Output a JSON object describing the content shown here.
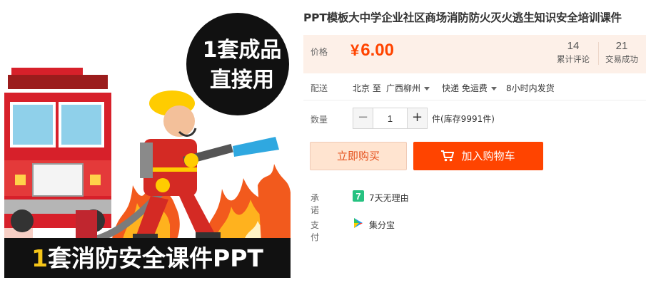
{
  "product": {
    "title": "PPT模板大中学企业社区商场消防防火灭火逃生知识安全培训课件",
    "image": {
      "badge_line1": "1套成品",
      "badge_line2": "直接用",
      "banner_accent": "1",
      "banner_text": "套消防安全课件PPT"
    }
  },
  "price": {
    "label": "价格",
    "currency": "¥",
    "value": "6.00",
    "color": "#ff4400"
  },
  "stats": {
    "reviews_count": "14",
    "reviews_label": "累计评论",
    "sold_count": "21",
    "sold_label": "交易成功"
  },
  "shipping": {
    "label": "配送",
    "from": "北京 至",
    "to": "广西柳州",
    "method": "快递 免运费",
    "dispatch": "8小时内发货"
  },
  "quantity": {
    "label": "数量",
    "minus": "−",
    "value": "1",
    "plus": "+",
    "stock": "件(库存9991件)"
  },
  "actions": {
    "buy_now": "立即购买",
    "add_to_cart": "加入购物车"
  },
  "promise": {
    "label": "承诺",
    "icon": "seven-day-return-icon",
    "icon_text": "7",
    "text": "7天无理由"
  },
  "payment": {
    "label": "支付",
    "icon": "jifenbao-icon",
    "text": "集分宝"
  }
}
